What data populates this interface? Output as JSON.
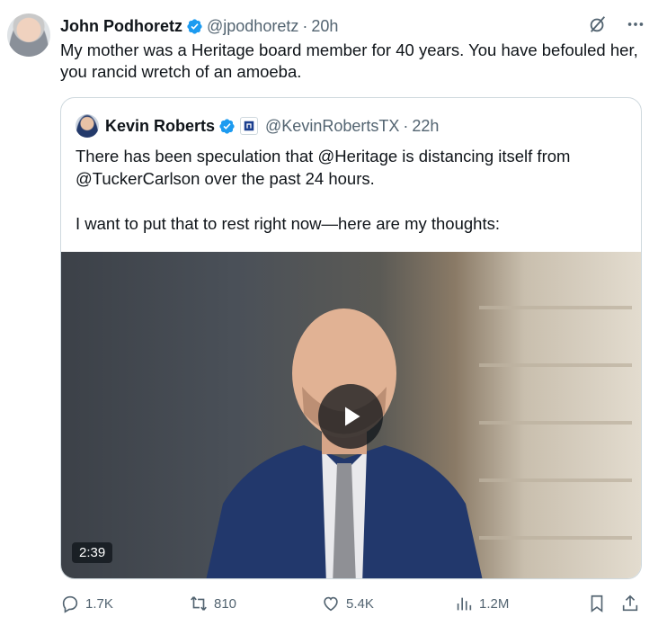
{
  "tweet": {
    "author_name": "John Podhoretz",
    "handle": "@jpodhoretz",
    "separator": "·",
    "time": "20h",
    "text": "My mother was a  Heritage board member for 40 years. You have befouled her, you rancid wretch of an amoeba."
  },
  "quote": {
    "author_name": "Kevin Roberts",
    "handle": "@KevinRobertsTX",
    "separator": "·",
    "time": "22h",
    "paragraph1": "There has been speculation that @Heritage is distancing itself from @TuckerCarlson over the past 24 hours.",
    "paragraph2": "I want to put that to rest right now—here are my thoughts:",
    "video_duration": "2:39"
  },
  "actions": {
    "replies": "1.7K",
    "reposts": "810",
    "likes": "5.4K",
    "views": "1.2M"
  },
  "colors": {
    "verified": "#1d9bf0",
    "secondary_text": "#536471",
    "border": "#cfd9de"
  }
}
